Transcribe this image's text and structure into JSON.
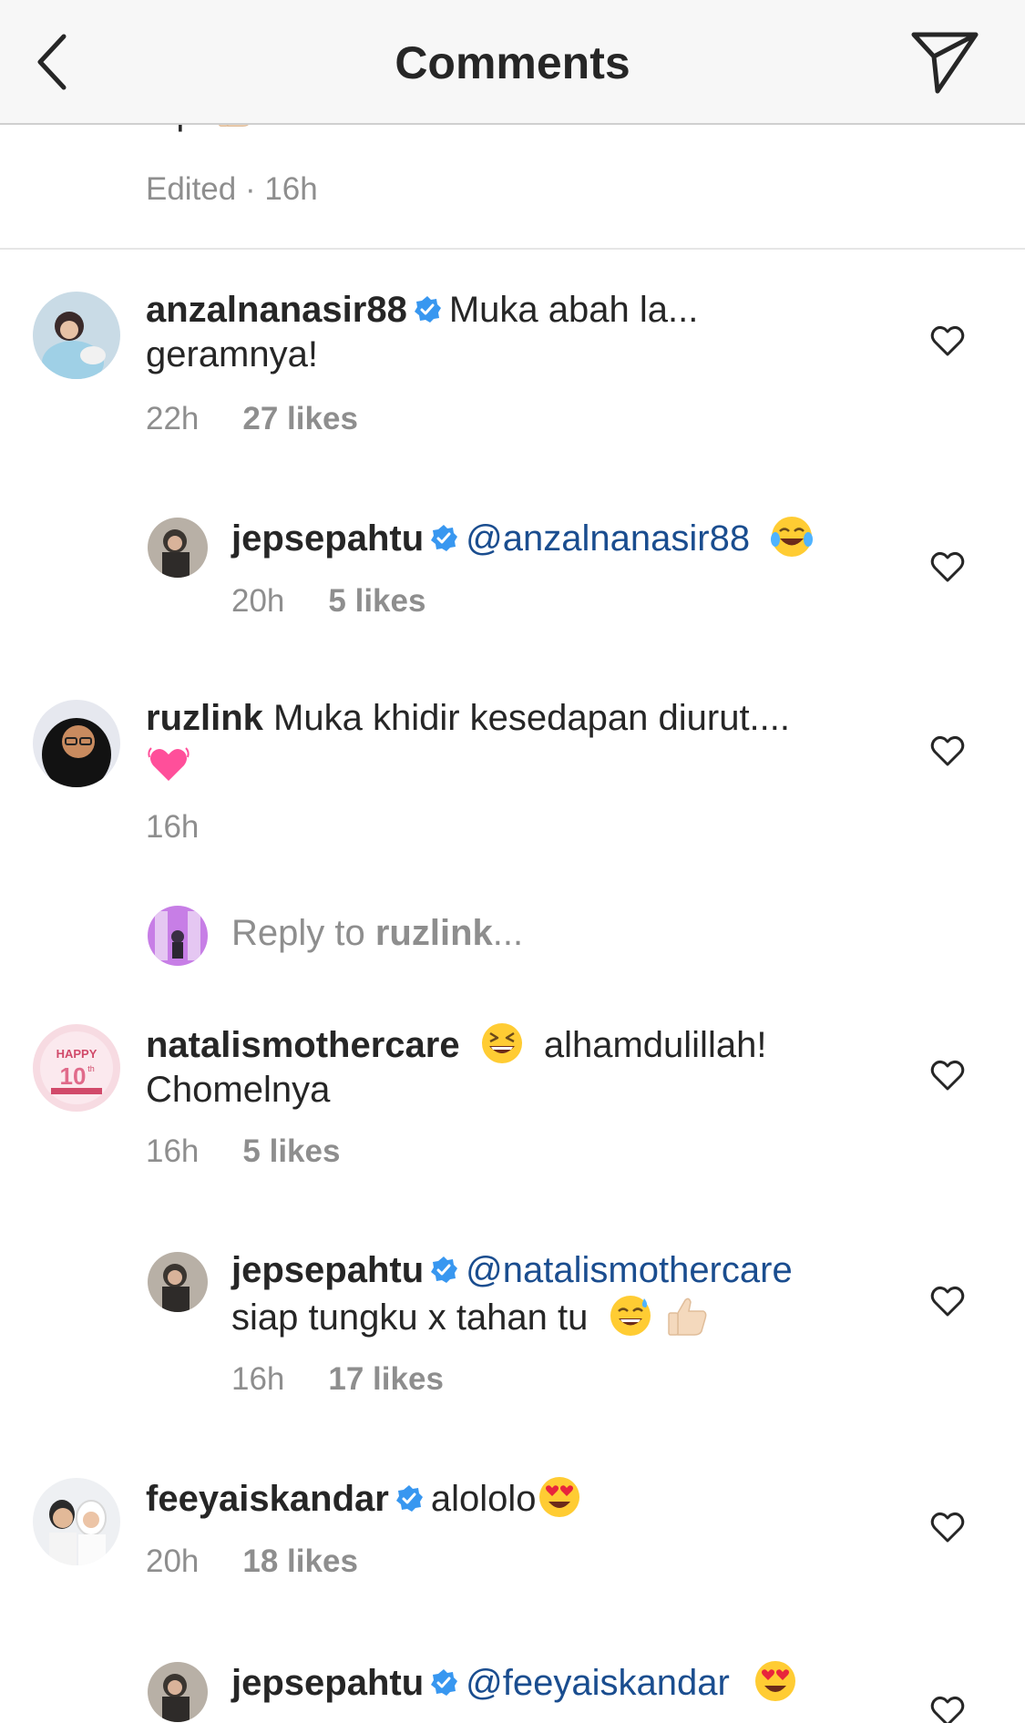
{
  "header": {
    "title": "Comments"
  },
  "top_fragment": {
    "text": "top",
    "meta": "Edited · 16h"
  },
  "comments": [
    {
      "user": "anzalnanasir88",
      "verified": true,
      "text_line1": "Muka abah la...",
      "text_line2": "geramnya!",
      "time": "22h",
      "likes": "27 likes"
    },
    {
      "user": "jepsepahtu",
      "verified": true,
      "mention": "@anzalnanasir88",
      "time": "20h",
      "likes": "5 likes"
    },
    {
      "user": "ruzlink",
      "verified": false,
      "text_line1": "Muka khidir kesedapan diurut....",
      "time": "16h"
    },
    {
      "reply_prefix": "Reply to ",
      "reply_user": "ruzlink",
      "reply_suffix": "..."
    },
    {
      "user": "natalismothercare",
      "verified": false,
      "text_line1": "alhamdulillah!",
      "text_line2": "Chomelnya",
      "time": "16h",
      "likes": "5 likes"
    },
    {
      "user": "jepsepahtu",
      "verified": true,
      "mention": "@natalismothercare",
      "text_line2": "siap tungku x tahan tu",
      "time": "16h",
      "likes": "17 likes"
    },
    {
      "user": "feeyaiskandar",
      "verified": true,
      "text_line1": "alololo",
      "time": "20h",
      "likes": "18 likes"
    },
    {
      "user": "jepsepahtu",
      "verified": true,
      "mention": "@feeyaiskandar"
    }
  ],
  "avatar_badge_text": {
    "line1": "HAPPY",
    "line2": "10",
    "line3": "th"
  },
  "icons": [
    "back-arrow-icon",
    "send-icon",
    "verified-badge-icon",
    "heart-icon"
  ],
  "colors": {
    "verified": "#3897f0",
    "mention": "#1a4d8f",
    "meta": "#8e8e8e",
    "heart_outline": "#262626"
  }
}
